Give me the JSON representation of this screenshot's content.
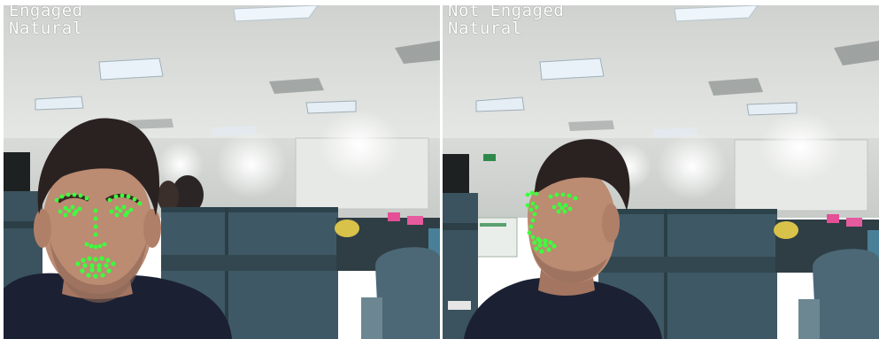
{
  "frames": [
    {
      "id": "left",
      "status": "Engaged",
      "expression": "Natural"
    },
    {
      "id": "right",
      "status": "Not Engaged",
      "expression": "Natural"
    }
  ],
  "colors": {
    "landmark": "#3dff3d",
    "ceiling": "#d9dbd8",
    "wall": "#e4e6e3",
    "cubicle": "#3f5a66",
    "shirt": "#1b2133",
    "skin": "#b98a72",
    "hair": "#2a2220",
    "overlay_text": "#ffffff"
  },
  "icons": {
    "landmarks": "facial-landmark-dots"
  }
}
